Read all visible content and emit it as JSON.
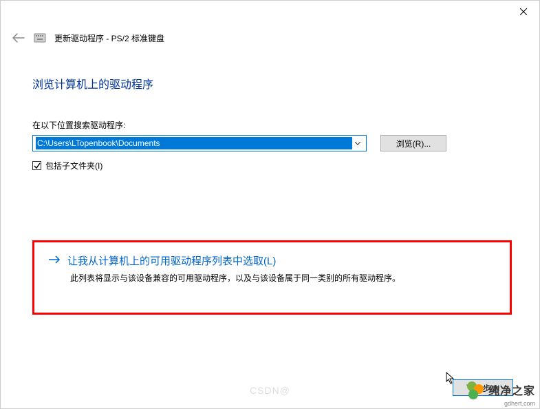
{
  "titlebar": {
    "close_tooltip": "关闭"
  },
  "header": {
    "title": "更新驱动程序 - PS/2 标准键盘"
  },
  "main": {
    "page_title": "浏览计算机上的驱动程序",
    "search_label": "在以下位置搜索驱动程序:",
    "path_value": "C:\\Users\\LTopenbook\\Documents",
    "browse_label": "浏览(R)...",
    "include_subfolders_label": "包括子文件夹(I)",
    "include_subfolders_checked": true
  },
  "option": {
    "title": "让我从计算机上的可用驱动程序列表中选取(L)",
    "description": "此列表将显示与该设备兼容的可用驱动程序，以及与该设备属于同一类别的所有驱动程序。"
  },
  "footer": {
    "next_label": "下一步(N"
  },
  "watermark": {
    "brand": "纯净之家",
    "domain": "gdhert.com",
    "csdn": "CSDN@"
  }
}
